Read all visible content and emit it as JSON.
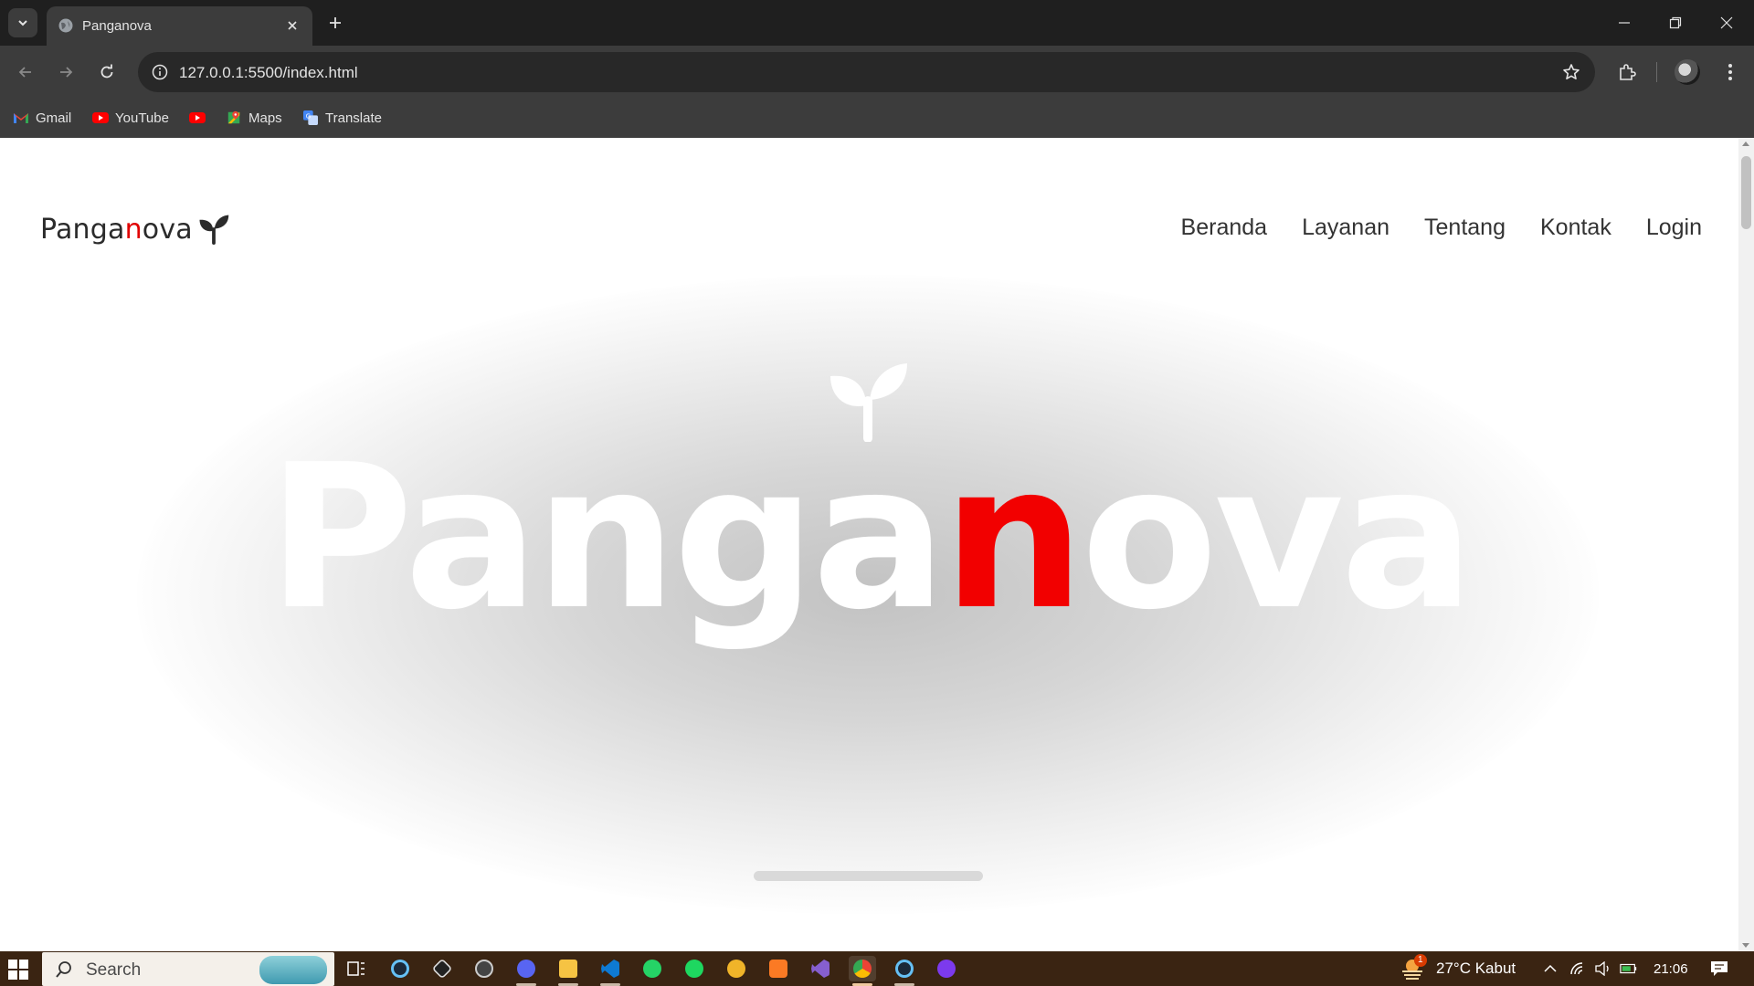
{
  "browser": {
    "tab_title": "Panganova",
    "url": "127.0.0.1:5500/index.html",
    "bookmarks": [
      {
        "label": "Gmail",
        "icon": "gmail-icon"
      },
      {
        "label": "YouTube",
        "icon": "youtube-icon"
      },
      {
        "label": "",
        "icon": "youtube-icon"
      },
      {
        "label": "Maps",
        "icon": "maps-icon"
      },
      {
        "label": "Translate",
        "icon": "translate-icon"
      }
    ]
  },
  "page": {
    "brand": {
      "prefix": "Panga",
      "accent": "n",
      "suffix": "ova"
    },
    "nav": [
      "Beranda",
      "Layanan",
      "Tentang",
      "Kontak",
      "Login"
    ],
    "hero": {
      "prefix": "Panga",
      "accent": "n",
      "suffix": "ova"
    },
    "colors": {
      "accent": "#e10000",
      "text": "#2b2b2b"
    }
  },
  "taskbar": {
    "search_placeholder": "Search",
    "weather": "27°C  Kabut",
    "weather_badge": "1",
    "time": "21:06",
    "apps": [
      "task-view-icon",
      "steam-icon",
      "unity-icon",
      "app-icon",
      "discord-icon",
      "file-explorer-icon",
      "vscode-icon",
      "whatsapp-icon",
      "spotify-icon",
      "app-icon",
      "xampp-icon",
      "visual-studio-icon",
      "chrome-icon",
      "steam-icon",
      "github-desktop-icon"
    ]
  }
}
